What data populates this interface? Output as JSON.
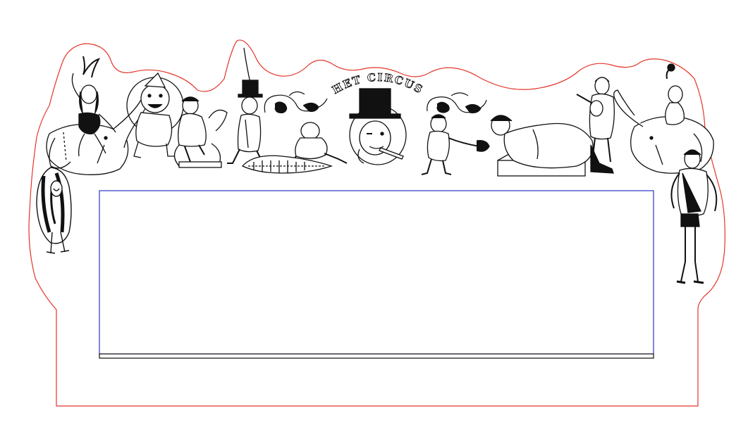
{
  "artwork": {
    "title": "HET CIRCUS",
    "cut_outline_color": "#e4352a",
    "panel_outline_color": "#2b35c9",
    "ink_color": "#111111"
  },
  "figures": [
    {
      "name": "contortionist-figure"
    },
    {
      "name": "left-elephant-figure"
    },
    {
      "name": "showgirl-figure"
    },
    {
      "name": "clown-in-hoop-figure"
    },
    {
      "name": "equestrienne-figure"
    },
    {
      "name": "ringmaster-figure"
    },
    {
      "name": "crocodile-wrestler-figure"
    },
    {
      "name": "cigar-strongman-portrait"
    },
    {
      "name": "fire-eater-figure"
    },
    {
      "name": "reclining-fat-lady-figure"
    },
    {
      "name": "guitarist-figure"
    },
    {
      "name": "right-elephant-figure"
    },
    {
      "name": "strongman-figure"
    }
  ]
}
